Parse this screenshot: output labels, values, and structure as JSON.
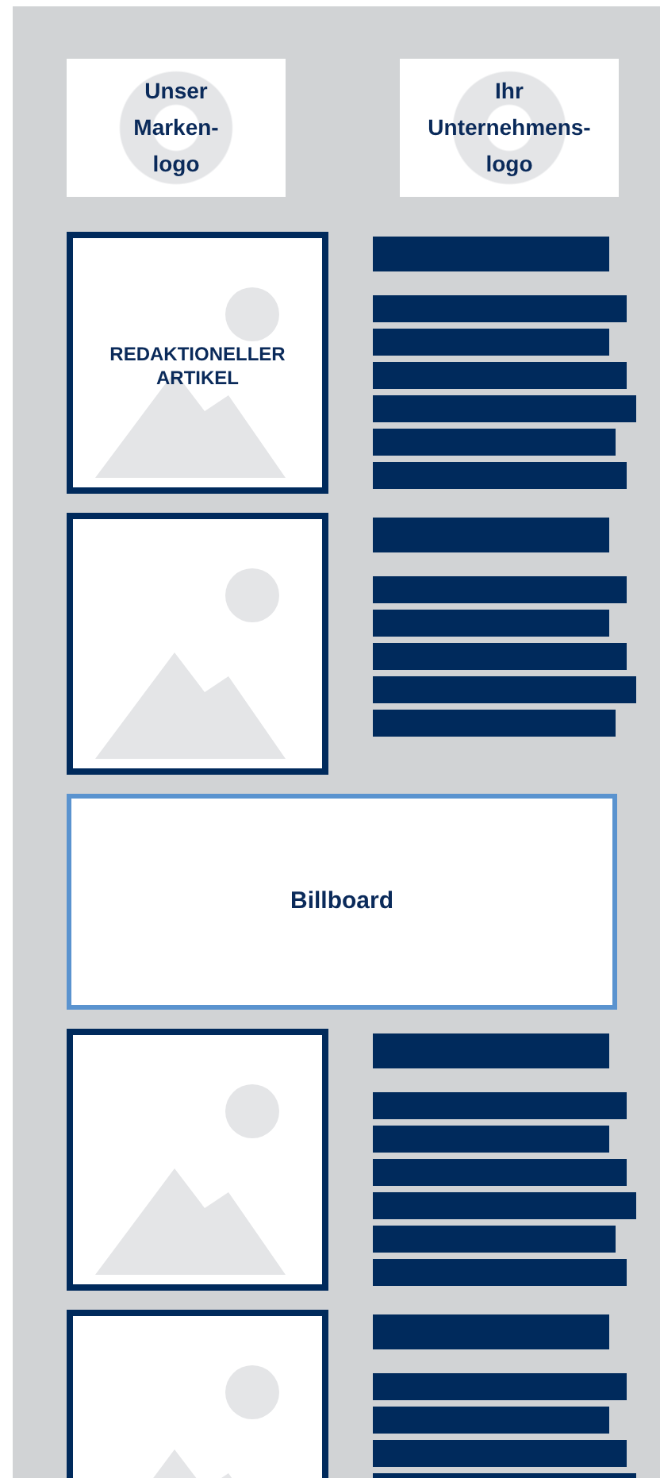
{
  "logos": [
    {
      "label": "Unser\nMarken-\nlogo"
    },
    {
      "label": "Ihr\nUnternehmens-\nlogo"
    }
  ],
  "feed": [
    {
      "kind": "article",
      "label": "REDAKTIONELLER\nARTIKEL"
    },
    {
      "kind": "article"
    },
    {
      "kind": "billboard",
      "label": "Billboard"
    },
    {
      "kind": "article"
    },
    {
      "kind": "article"
    }
  ]
}
